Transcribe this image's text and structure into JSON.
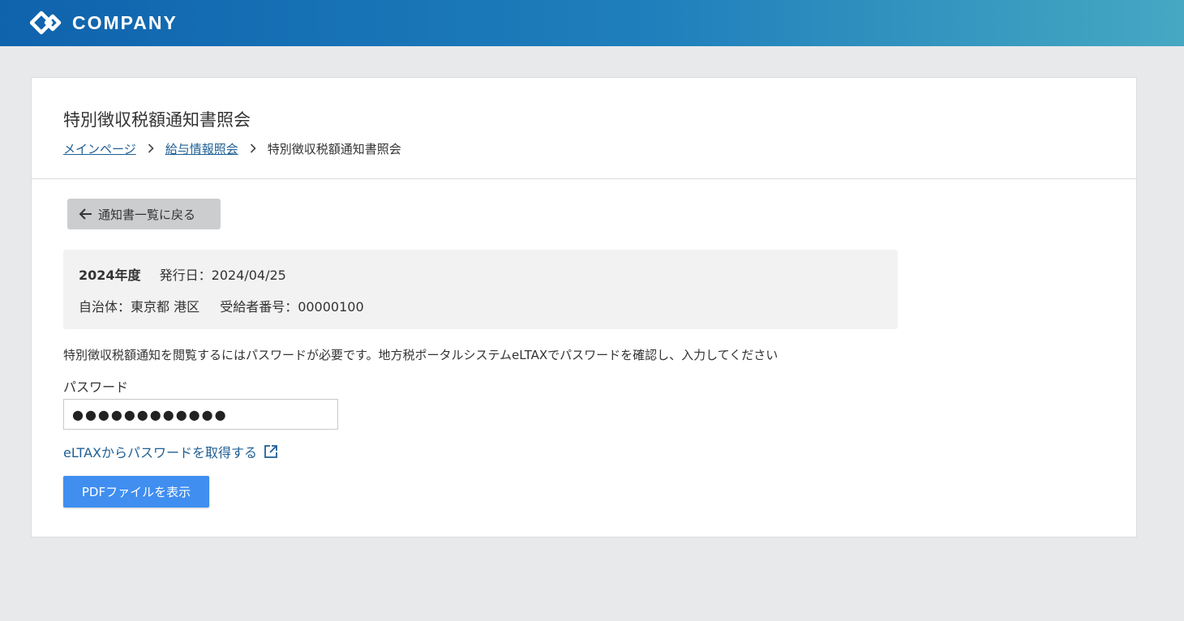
{
  "header": {
    "brand": "COMPANY",
    "logo_icon": "diamond-link-logo-icon"
  },
  "page": {
    "title": "特別徴収税額通知書照会",
    "breadcrumb": {
      "items": [
        {
          "label": "メインページ"
        },
        {
          "label": "給与情報照会"
        }
      ],
      "current": "特別徴収税額通知書照会",
      "separator_icon": "chevron-right-icon"
    }
  },
  "back_button": {
    "label": "通知書一覧に戻る",
    "icon": "arrow-left-icon"
  },
  "notice_info": {
    "year": "2024年度",
    "issue_date": "発行日：2024/04/25",
    "municipality": "自治体：東京都 港区",
    "recipient_number": "受給者番号：00000100"
  },
  "form": {
    "description": "特別徴収税額通知を閲覧するにはパスワードが必要です。地方税ポータルシステムeLTAXでパスワードを確認し、入力してください",
    "password_label": "パスワード",
    "password_value": "●●●●●●●●●●●●",
    "eltax_link": "eLTAXからパスワードを取得する",
    "eltax_link_icon": "external-link-icon",
    "submit_label": "PDFファイルを表示"
  },
  "colors": {
    "header_gradient_start": "#0f63ad",
    "header_gradient_end": "#46a8c2",
    "primary_button": "#3f8ef0",
    "link": "#1f5f95",
    "background": "#e8e9eb"
  }
}
